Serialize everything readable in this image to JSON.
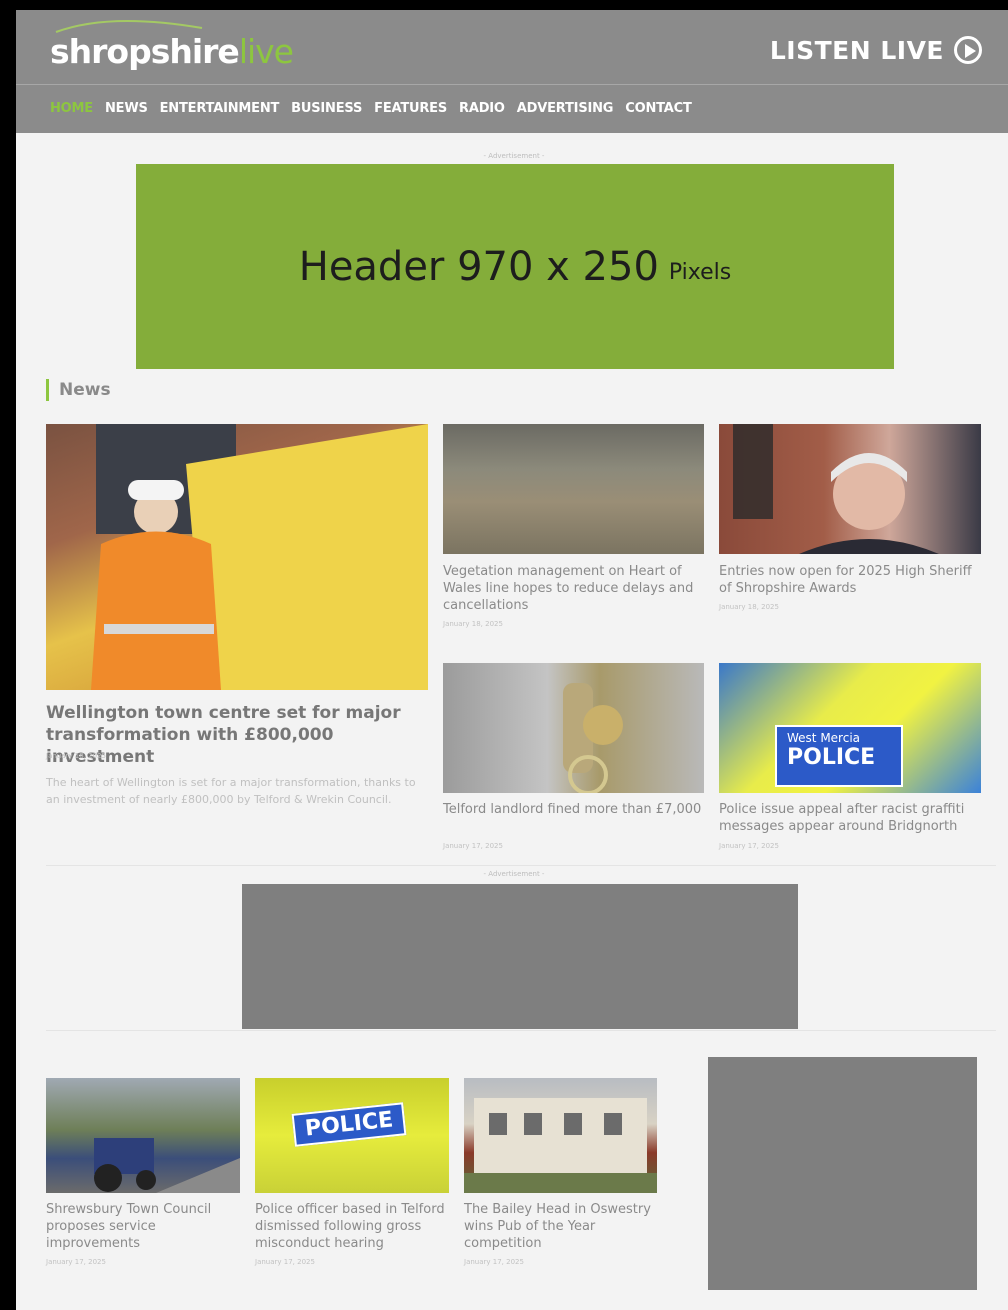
{
  "header": {
    "logo_main": "shropshire",
    "logo_accent": "live",
    "listen_live": "LISTEN LIVE"
  },
  "nav": {
    "items": [
      "HOME",
      "NEWS",
      "ENTERTAINMENT",
      "BUSINESS",
      "FEATURES",
      "RADIO",
      "ADVERTISING",
      "CONTACT"
    ],
    "active": "HOME"
  },
  "ads": {
    "label": "- Advertisement -",
    "header_text": "Header 970 x 250",
    "header_unit": "Pixels"
  },
  "section": {
    "title": "News"
  },
  "feature": {
    "title": "Wellington town centre set for major transformation with £800,000 investment",
    "date": "January 18, 2025",
    "excerpt": "The heart of Wellington is set for a major transformation, thanks to an investment of nearly £800,000 by Telford & Wrekin Council."
  },
  "cards": [
    {
      "title": "Vegetation management on Heart of Wales line hopes to reduce delays and cancellations",
      "date": "January 18, 2025"
    },
    {
      "title": "Entries now open for 2025 High Sheriff of Shropshire Awards",
      "date": "January 18, 2025"
    },
    {
      "title": "Telford landlord fined more than £7,000",
      "date": "January 17, 2025"
    },
    {
      "title": "Police issue appeal after racist graffiti messages appear around Bridgnorth",
      "date": "January 17, 2025"
    }
  ],
  "bottom_cards": [
    {
      "title": "Shrewsbury Town Council proposes service improvements",
      "date": "January 17, 2025"
    },
    {
      "title": "Police officer based in Telford dismissed following gross misconduct hearing",
      "date": "January 17, 2025"
    },
    {
      "title": "The Bailey Head in Oswestry wins Pub of the Year competition",
      "date": "January 17, 2025"
    }
  ],
  "image_text": {
    "police_badge": "POLICE",
    "west_mercia": "West Mercia"
  },
  "colors": {
    "accent": "#8dc63f",
    "header_bg": "#8b8b8b",
    "ad_green": "#84ad3a"
  }
}
